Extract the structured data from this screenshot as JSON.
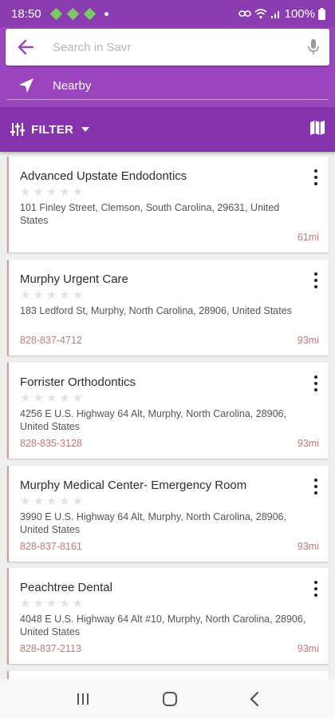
{
  "status": {
    "time": "18:50",
    "battery": "100%"
  },
  "search": {
    "placeholder": "Search in Savr"
  },
  "nearby": {
    "label": "Nearby"
  },
  "filter": {
    "label": "FILTER"
  },
  "results": [
    {
      "name": "Advanced Upstate Endodontics",
      "rating": 0,
      "address": "101 Finley Street, Clemson, South Carolina, 29631, United States",
      "phone": "",
      "distance": "61mi"
    },
    {
      "name": "Murphy Urgent Care",
      "rating": 0,
      "address": "183 Ledford St, Murphy, North Carolina, 28906, United States",
      "phone": "828-837-4712",
      "distance": "93mi"
    },
    {
      "name": "Forrister Orthodontics",
      "rating": 0,
      "address": "4256 E U.S. Highway 64 Alt, Murphy, North Carolina, 28906, United States",
      "phone": "828-835-3128",
      "distance": "93mi"
    },
    {
      "name": "Murphy Medical Center- Emergency Room",
      "rating": 0,
      "address": "3990 E U.S. Highway 64 Alt, Murphy, North Carolina, 28906, United States",
      "phone": "828-837-8161",
      "distance": "93mi"
    },
    {
      "name": "Peachtree Dental",
      "rating": 0,
      "address": "4048 E U.S. Highway 64 Alt #10, Murphy, North Carolina, 28906, United States",
      "phone": "828-837-2113",
      "distance": "93mi"
    }
  ],
  "colors": {
    "status_bar": "#8a3cb0",
    "header": "#9a45bd",
    "filter_bar": "#8634ae",
    "accent_text": "#c07a7a"
  }
}
